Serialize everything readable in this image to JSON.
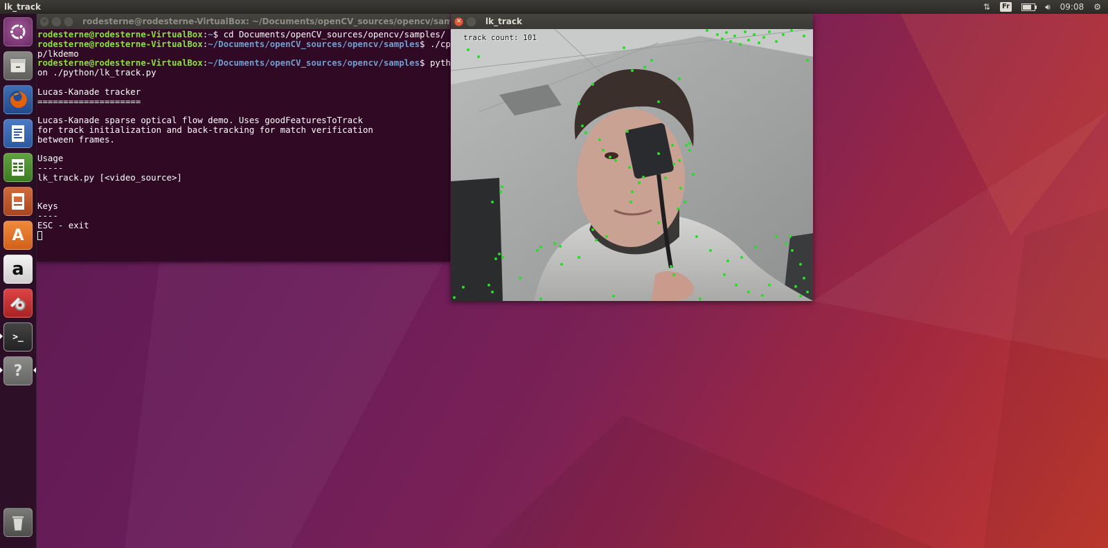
{
  "top_panel": {
    "app_title": "lk_track",
    "keyboard_layout": "Fr",
    "clock": "09:08",
    "battery_level": 0.8
  },
  "launcher": {
    "items": [
      {
        "name": "ubuntu-dash",
        "icon": "ubuntu-logo-icon"
      },
      {
        "name": "files",
        "icon": "file-cabinet-icon"
      },
      {
        "name": "firefox",
        "icon": "firefox-icon"
      },
      {
        "name": "libreoffice-writer",
        "icon": "writer-document-icon"
      },
      {
        "name": "libreoffice-calc",
        "icon": "calc-spreadsheet-icon"
      },
      {
        "name": "libreoffice-impress",
        "icon": "impress-presentation-icon"
      },
      {
        "name": "ubuntu-software",
        "icon": "software-bag-icon",
        "glyph": "A"
      },
      {
        "name": "amazon",
        "icon": "amazon-icon",
        "glyph": "a"
      },
      {
        "name": "system-settings",
        "icon": "wrench-gear-icon"
      },
      {
        "name": "terminal",
        "icon": "terminal-icon",
        "glyph": ">_"
      },
      {
        "name": "help",
        "icon": "question-icon",
        "glyph": "?"
      },
      {
        "name": "trash",
        "icon": "trash-icon"
      }
    ]
  },
  "terminal": {
    "title": "rodesterne@rodesterne-VirtualBox: ~/Documents/openCV_sources/opencv/samples",
    "lines": [
      {
        "user": "rodesterne@rodesterne-VirtualBox",
        "sep": ":",
        "path": "~",
        "cmd": "$ cd Documents/openCV_sources/opencv/samples/"
      },
      {
        "user": "rodesterne@rodesterne-VirtualBox",
        "sep": ":",
        "path": "~/Documents/openCV_sources/opencv/samples",
        "cmd": "$ ./cp"
      },
      {
        "text": "p/lkdemo"
      },
      {
        "user": "rodesterne@rodesterne-VirtualBox",
        "sep": ":",
        "path": "~/Documents/openCV_sources/opencv/samples",
        "cmd": "$ pyth"
      },
      {
        "text": "on ./python/lk_track.py"
      },
      {
        "text": ""
      },
      {
        "text": "Lucas-Kanade tracker"
      },
      {
        "text": "===================="
      },
      {
        "text": ""
      },
      {
        "text": "Lucas-Kanade sparse optical flow demo. Uses goodFeaturesToTrack"
      },
      {
        "text": "for track initialization and back-tracking for match verification"
      },
      {
        "text": "between frames."
      },
      {
        "text": ""
      },
      {
        "text": "Usage"
      },
      {
        "text": "-----"
      },
      {
        "text": "lk_track.py [<video_source>]"
      },
      {
        "text": ""
      },
      {
        "text": ""
      },
      {
        "text": "Keys"
      },
      {
        "text": "----"
      },
      {
        "text": "ESC - exit"
      },
      {
        "text": ""
      }
    ]
  },
  "lk_window": {
    "title": "lk_track",
    "overlay": "track count: 101"
  },
  "colors": {
    "term_bg": "#300a24",
    "prompt_user": "#8ae234",
    "prompt_path": "#729fcf",
    "track_point": "#22e022"
  }
}
